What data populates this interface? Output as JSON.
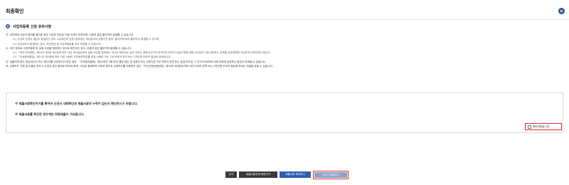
{
  "modal": {
    "title": "최종확인"
  },
  "notice": {
    "title": "사업자등록 신청 유의사항",
    "lines": [
      {
        "text": "가. 타인에게 사업자 명의를 빌려준 경우 사업과 관련된 각종 국세가 부과되며, 다음과 같은 불이익이 발생할 수 있습니다.",
        "sub": false
      },
      {
        "text": "(1) 사업과 관련된 체납이 발생하는 경우 소유재산의 압류·공매처분, 체납명세의 금융기관 통보, 출국규제 등의 불이익이 발생할 수 있으며,",
        "sub": true
      },
      {
        "text": "(2) 사업소득이 발생하는 경우, 국민연금 및 건강보험료를 추가 부담할 수 있습니다.",
        "sub": true
      },
      {
        "text": "나. 타인 명의로 사업자등록 및 실제 사업을 영위하는 것으로 확인되는 경우, 다음과 같은 불이익이 발생할 수 있습니다.",
        "sub": false
      },
      {
        "text": "(1) 「부가가치세법」제22조 제3항 제2호에 따라 사업 개시일로부터 실제 사업을 영위하는 것으로 확인되는 날의 속하는 예정신고기간(과세기간)까지의 공급가액에 대해 100분의 1에 상당하는 금액을 납부세액에 가산하여 납부하여야 합니다.",
        "sub": true
      },
      {
        "text": "(2) 「조세범처벌법」제11조 제1항에 따라 다른 사람의 주민등록번호를 부정 사용한 자는 1년 이하의 징역 또는 1천만원 이하의 벌금에 처해집니다.",
        "sub": true
      },
      {
        "text": "다. 실물거래 없이 세금계산서 또는 계산서를 교부하거나 받은 경우, 「조세범처벌법」제10조의 3에 따라 해당 법인 및 대표자 또는 관련인은 3년 이하의 징역 또는 공급가액 및 그 부가가치세액의 3배 이하에 상당하는 벌금이 부과될 수 있습니다.",
        "sub": false
      },
      {
        "text": "라. 신용카드 가맹 및 이용은 반드시 사업자 본인 명의로 하여야 하며, 사업상 결제목적 이외의 용도로 신용카드를 사용하는 경우 「여신전문금융업법」제70조 제2항에 따라 3년 이하의 징역 또는 2천만원 이하의 벌금에 처하는 처벌을 받을 수 있습니다.",
        "sub": false
      }
    ]
  },
  "confirm": {
    "line1": "※ 제출서류확인하기를 통하여 신청서 내용확인과 제출서류의 누락이 없는지 확인하시기 바랍니다.",
    "line2": "※ 제출서류를 확인한 경우에만 최종제출이 가능합니다.",
    "checkbox_label": "확인하였습니다.",
    "checked": false
  },
  "buttons": {
    "close": "닫기",
    "doc_select": "제출서류선택 화면가기",
    "doc_check": "제출서류 확인하기",
    "submit": "신청서 제출하기"
  },
  "colors": {
    "primary": "#2f5db0",
    "dark_button": "#3a3a3a",
    "disabled_button": "#8ea1cc",
    "highlight_border": "#d93025"
  }
}
